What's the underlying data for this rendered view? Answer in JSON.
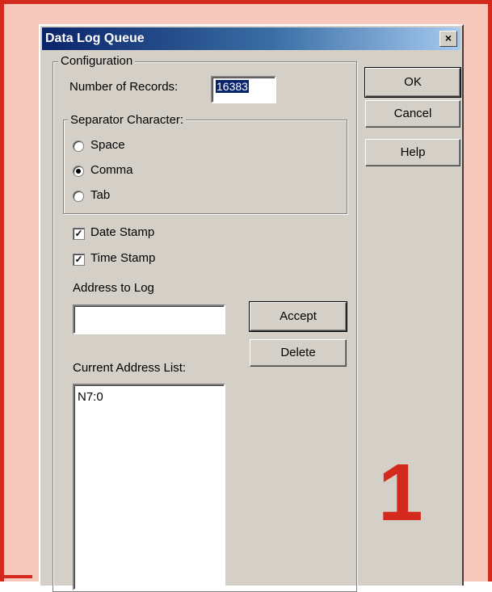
{
  "dialog": {
    "title": "Data Log Queue",
    "close_glyph": "×"
  },
  "configuration": {
    "caption": "Configuration",
    "records_label": "Number of Records:",
    "records_value": "16383",
    "separator": {
      "caption": "Separator Character:",
      "options": [
        {
          "label": "Space",
          "selected": false
        },
        {
          "label": "Comma",
          "selected": true
        },
        {
          "label": "Tab",
          "selected": false
        }
      ]
    },
    "date_stamp": {
      "label": "Date Stamp",
      "checked": true
    },
    "time_stamp": {
      "label": "Time Stamp",
      "checked": true
    },
    "address_label": "Address to Log",
    "address_value": "",
    "accept_label": "Accept",
    "delete_label": "Delete",
    "list_label": "Current Address List:",
    "list_items": [
      "N7:0"
    ]
  },
  "buttons": {
    "ok": "OK",
    "cancel": "Cancel",
    "help": "Help"
  },
  "annotation": {
    "number": "1",
    "color": "#d42a1e"
  },
  "colors": {
    "frame_border": "#d42a1e",
    "frame_fill": "#f7c8bc",
    "dialog_face": "#d4d0c8",
    "titlebar": "#0a246a"
  }
}
